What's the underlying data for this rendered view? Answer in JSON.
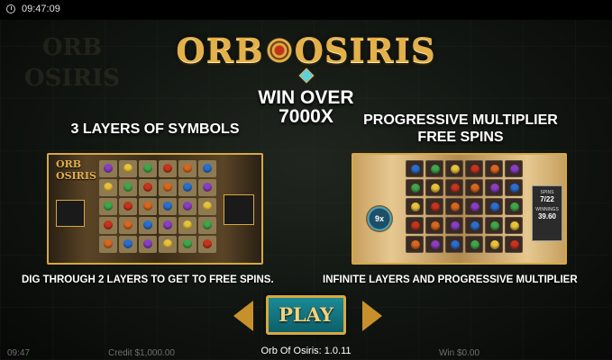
{
  "status_bar": {
    "time": "09:47:09"
  },
  "background": {
    "logo_word1": "ORB",
    "logo_word2": "OSIRIS"
  },
  "logo": {
    "part1": "ORB",
    "part2": "OSIRIS"
  },
  "headline": {
    "line1": "WIN OVER",
    "line2": "7000X"
  },
  "left_feature": {
    "title": "3 LAYERS OF SYMBOLS",
    "caption": "DIG THROUGH 2 LAYERS TO GET TO FREE SPINS.",
    "mini_logo_line1": "ORB",
    "mini_logo_line2": "OSIRIS"
  },
  "right_feature": {
    "title_line1": "PROGRESSIVE MULTIPLIER",
    "title_line2": "FREE SPINS",
    "caption": "INFINITE LAYERS AND PROGRESSIVE MULTIPLIER",
    "multiplier": "9x",
    "spins_label": "SPINS",
    "spins_value": "7/22",
    "winnings_label": "WINNINGS",
    "winnings_value": "39.60"
  },
  "play_button": {
    "label": "PLAY"
  },
  "bottom_bar": {
    "time": "09:47",
    "credit": "Credit $1,000.00",
    "win": "Win $0.00",
    "version": "Orb Of Osiris: 1.0.11"
  },
  "colors": {
    "gold": "#d7a93e",
    "teal_button": "#1c8a96",
    "red": "#c8331e",
    "green": "#3fa64a",
    "blue": "#2a6fd0",
    "purple": "#8a3ec2",
    "yellow": "#e8c33a",
    "orange": "#d9661f"
  }
}
